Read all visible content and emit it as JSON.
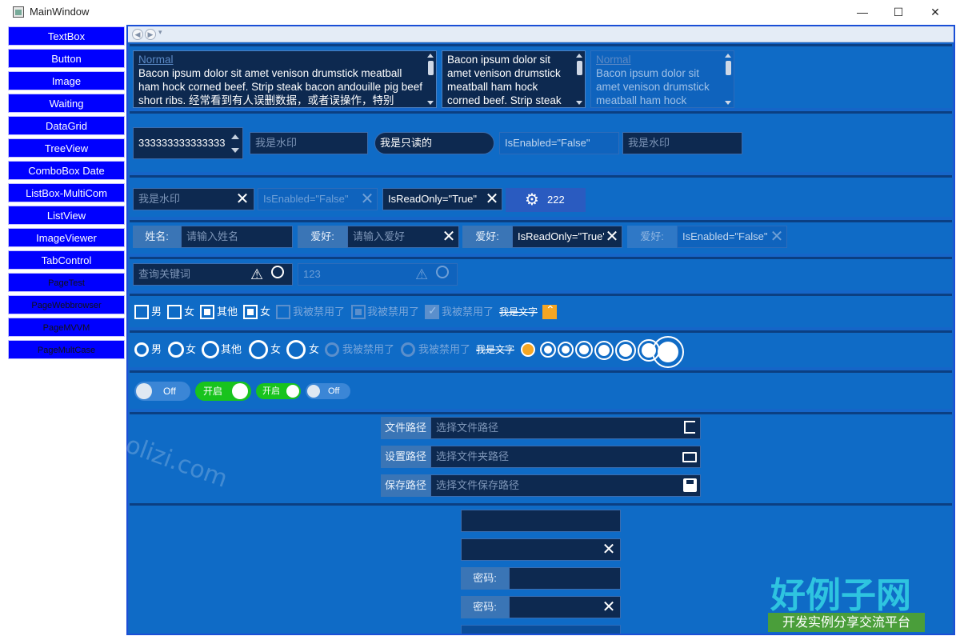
{
  "window": {
    "title": "MainWindow",
    "minimize_glyph": "—",
    "maximize_glyph": "☐",
    "close_glyph": "✕"
  },
  "nav": {
    "items": [
      {
        "label": "TextBox"
      },
      {
        "label": "Button"
      },
      {
        "label": "Image"
      },
      {
        "label": "Waiting"
      },
      {
        "label": "DataGrid"
      },
      {
        "label": "TreeView"
      },
      {
        "label": "ComboBox Date"
      },
      {
        "label": "ListBox-MultiCom"
      },
      {
        "label": "ListView"
      },
      {
        "label": "ImageViewer"
      },
      {
        "label": "TabControl"
      },
      {
        "label": "PageTest"
      },
      {
        "label": "PageWebbrowser"
      },
      {
        "label": "PageMVVM"
      },
      {
        "label": "PageMultCase"
      }
    ]
  },
  "textareas": {
    "a": {
      "label": "Normal",
      "text": "Bacon ipsum dolor sit amet venison drumstick meatball ham hock corned beef. Strip steak bacon andouille pig beef short ribs. 经常看到有人误删数据，或者误操作，特别"
    },
    "b": {
      "text": "Bacon ipsum dolor sit amet venison drumstick meatball ham hock corned beef. Strip steak"
    },
    "c": {
      "label": "Normal",
      "text": "Bacon ipsum dolor sit amet venison drumstick meatball ham hock"
    }
  },
  "row2": {
    "numeric_value": "333333333333333",
    "watermark1": "我是水印",
    "readonly_value": "我是只读的",
    "disabled_value": "IsEnabled=\"False\"",
    "watermark2": "我是水印"
  },
  "row3": {
    "watermark": "我是水印",
    "disabled": "IsEnabled=\"False\"",
    "readonly": "IsReadOnly=\"True\"",
    "gear_value": "222"
  },
  "row4": {
    "name_label": "姓名:",
    "name_placeholder": "请输入姓名",
    "hobby_label": "爱好:",
    "hobby_placeholder": "请输入爱好",
    "hobby2_label": "爱好:",
    "hobby2_value": "IsReadOnly=\"True\"",
    "hobby3_label": "爱好:",
    "hobby3_value": "IsEnabled=\"False\""
  },
  "row5": {
    "search_placeholder": "查询关键词",
    "search2_value": "123"
  },
  "checkboxes": [
    {
      "label": "男",
      "checked": false
    },
    {
      "label": "女",
      "checked": false
    },
    {
      "label": "其他",
      "checked": "partial"
    },
    {
      "label": "女",
      "checked": "partial"
    },
    {
      "label": "我被禁用了",
      "checked": false,
      "disabled": true
    },
    {
      "label": "我被禁用了",
      "checked": "partial",
      "disabled": true
    },
    {
      "label": "我被禁用了",
      "checked": true,
      "disabled": true
    },
    {
      "label": "我是文字",
      "checked": true
    }
  ],
  "radios": [
    {
      "label": "男"
    },
    {
      "label": "女"
    },
    {
      "label": "其他"
    },
    {
      "label": "女"
    },
    {
      "label": "女"
    },
    {
      "label": "我被禁用了"
    },
    {
      "label": "我被禁用了"
    },
    {
      "label": "我是文字"
    }
  ],
  "toggles": [
    {
      "label": "Off",
      "on": false
    },
    {
      "label": "开启",
      "on": true
    },
    {
      "label": "开启",
      "on": true
    },
    {
      "label": "Off",
      "on": false
    }
  ],
  "paths": [
    {
      "label": "文件路径",
      "placeholder": "选择文件路径",
      "icon": "file-open-icon"
    },
    {
      "label": "设置路径",
      "placeholder": "选择文件夹路径",
      "icon": "folder-icon"
    },
    {
      "label": "保存路径",
      "placeholder": "选择文件保存路径",
      "icon": "save-icon"
    }
  ],
  "passwords": {
    "label1": "密码:",
    "label2": "密码:"
  },
  "watermark": {
    "site": "www.haolizi.com",
    "brand": "好例子网",
    "slogan": "开发实例分享交流平台"
  },
  "colors": {
    "nav_button": "#0000ff",
    "panel": "#0f6bc6",
    "input_bg": "#0d2950",
    "toggle_on": "#18c31d",
    "checked_orange": "#f5a623"
  }
}
